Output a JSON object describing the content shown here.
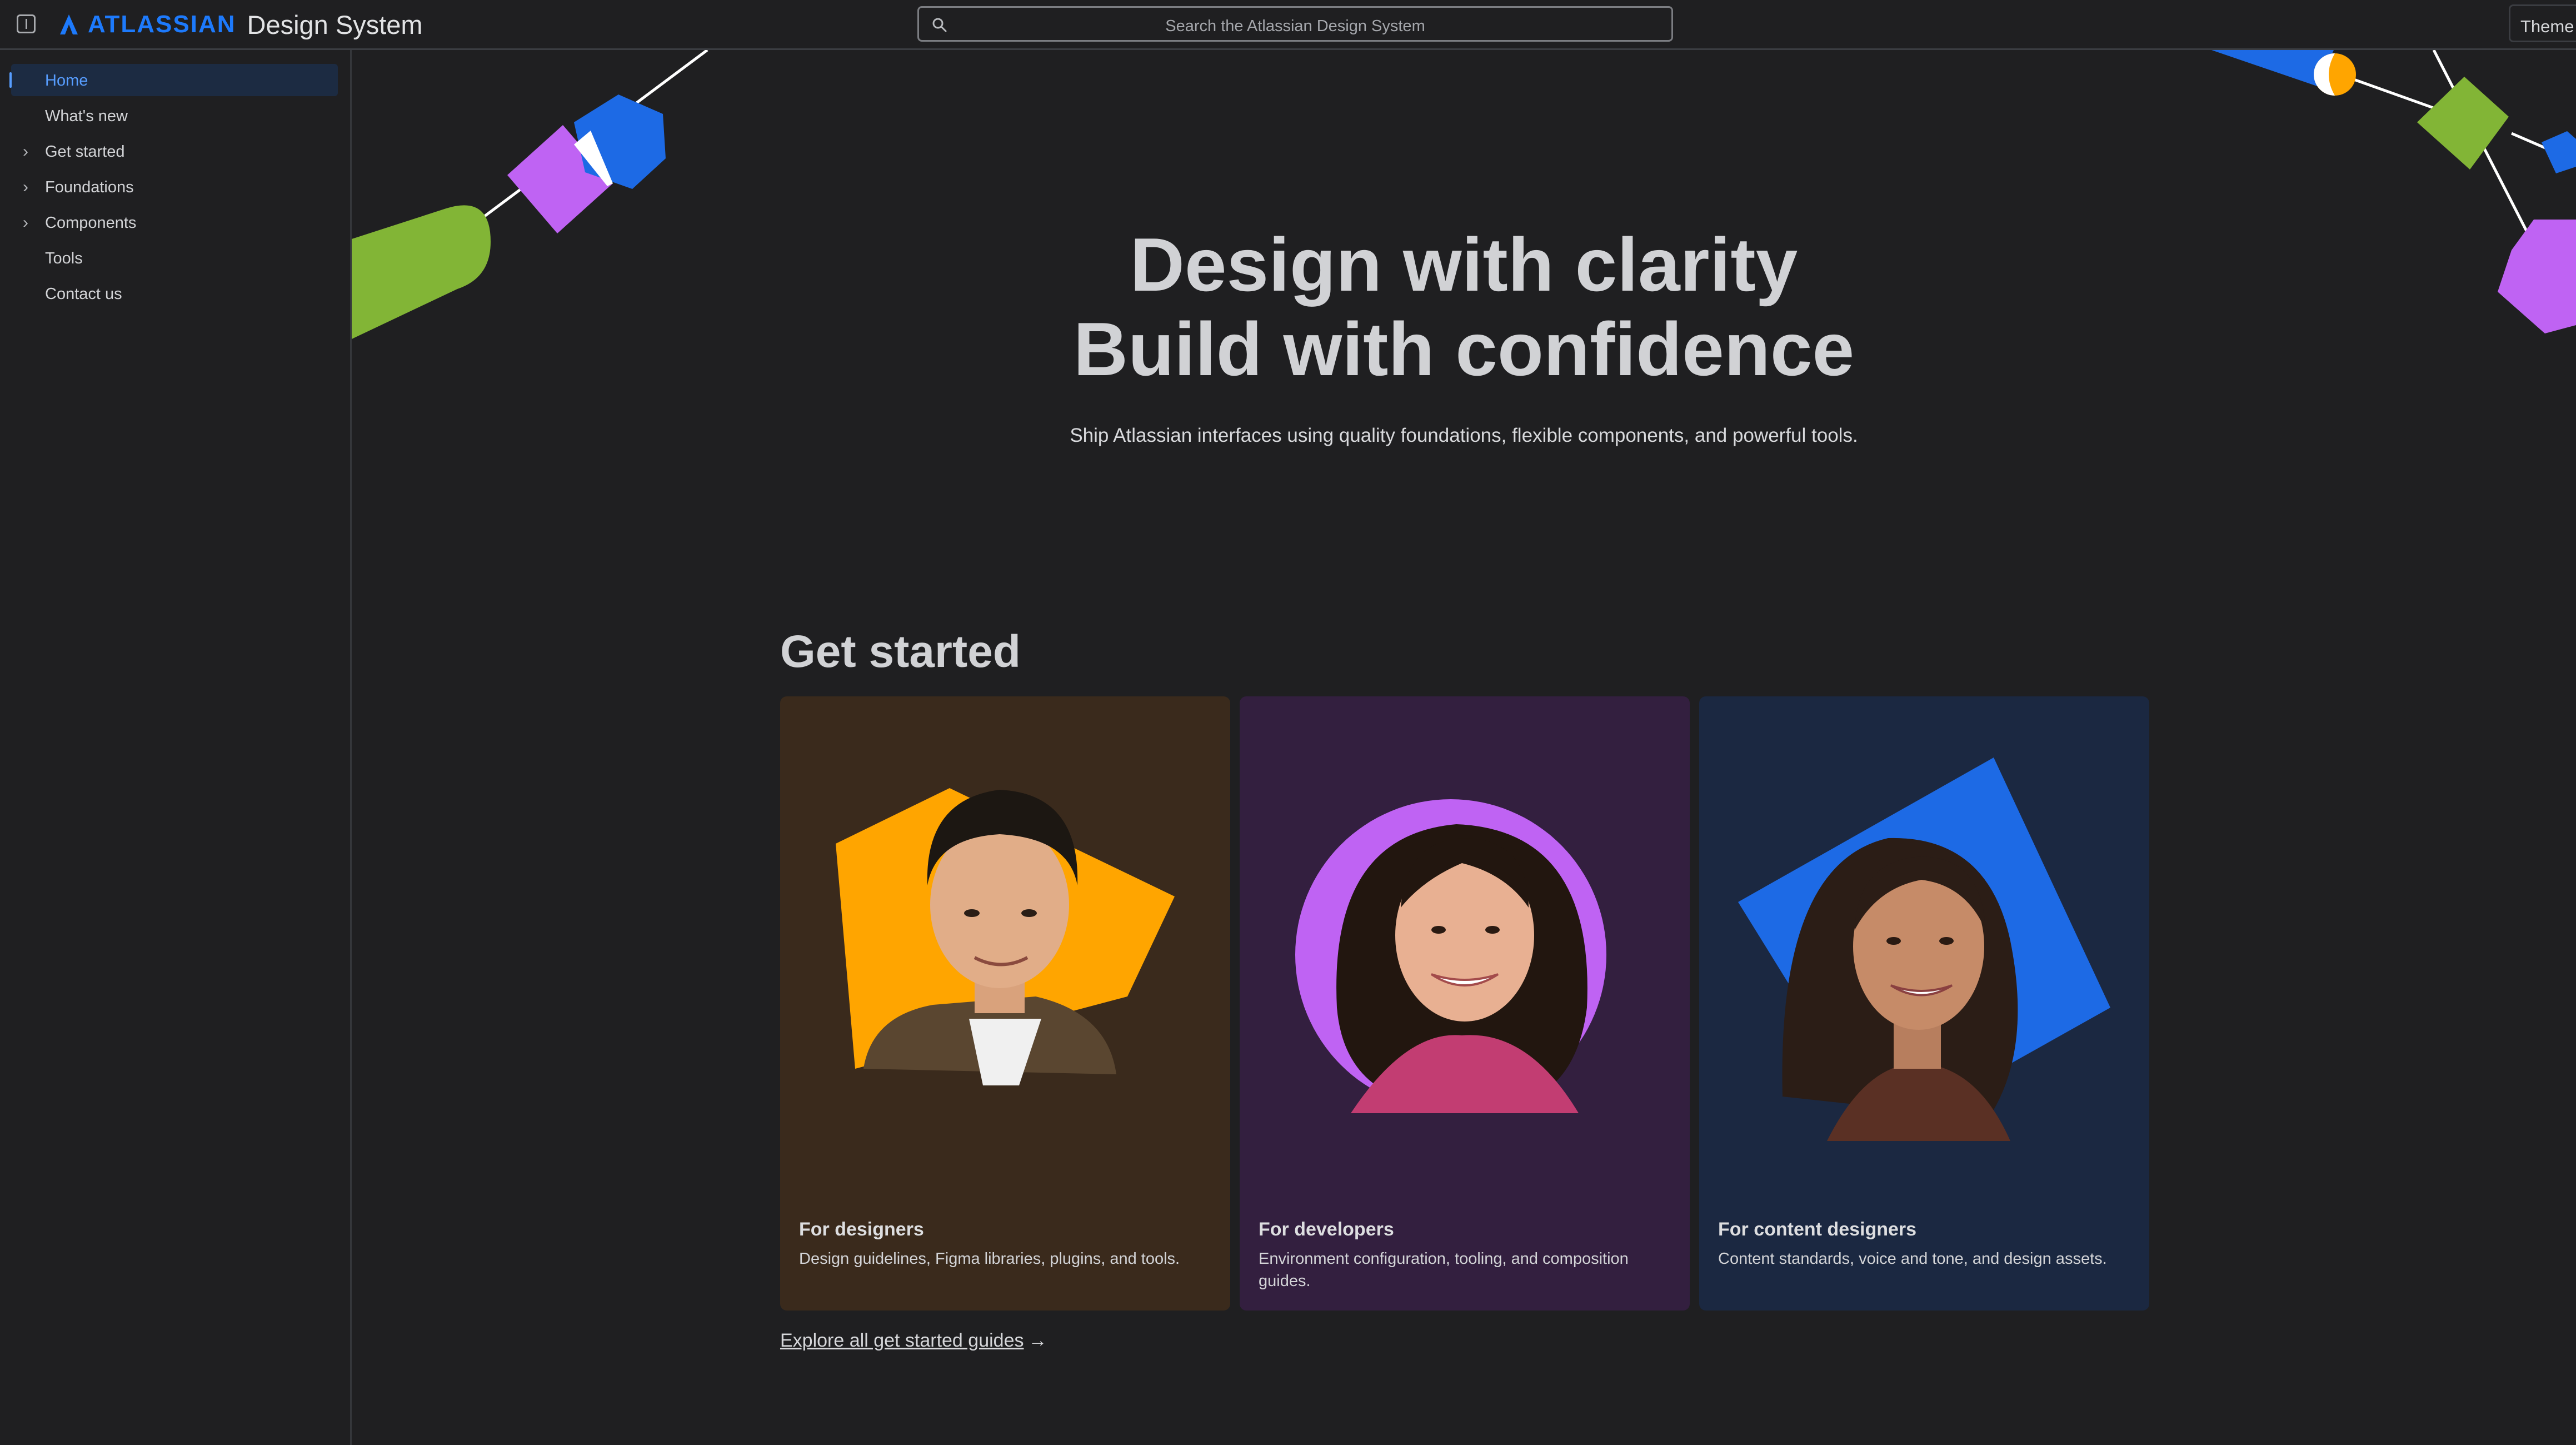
{
  "topbar": {
    "brand": "ATLASSIAN",
    "product": "Design System",
    "search_placeholder": "Search the Atlassian Design System",
    "theme_label": "Theme"
  },
  "sidebar": {
    "items": [
      {
        "label": "Home",
        "active": true,
        "expandable": false
      },
      {
        "label": "What's new",
        "active": false,
        "expandable": false
      },
      {
        "label": "Get started",
        "active": false,
        "expandable": true
      },
      {
        "label": "Foundations",
        "active": false,
        "expandable": true
      },
      {
        "label": "Components",
        "active": false,
        "expandable": true
      },
      {
        "label": "Tools",
        "active": false,
        "expandable": false
      },
      {
        "label": "Contact us",
        "active": false,
        "expandable": false
      }
    ]
  },
  "hero": {
    "title_line1": "Design with clarity",
    "title_line2": "Build with confidence",
    "subtitle": "Ship Atlassian interfaces using quality foundations, flexible components, and powerful tools."
  },
  "get_started": {
    "heading": "Get started",
    "cards": [
      {
        "title": "For designers",
        "description": "Design guidelines, Figma libraries, plugins, and tools.",
        "background": "#3a2a1c",
        "accent": "#ffa500"
      },
      {
        "title": "For developers",
        "description": "Environment configuration, tooling, and composition guides.",
        "background": "#331f3f",
        "accent": "#bf63f3"
      },
      {
        "title": "For content designers",
        "description": "Content standards, voice and tone, and design assets.",
        "background": "#1b2841",
        "accent": "#1d6ae5"
      }
    ],
    "explore_label": "Explore all get started guides",
    "explore_arrow": "→"
  },
  "colors": {
    "brand_blue": "#1d7afc",
    "link_blue": "#579dff",
    "green": "#82b536",
    "purple": "#bf63f3",
    "orange": "#ffa500"
  },
  "icons": [
    "sidebar-toggle-icon",
    "atlassian-logo-icon",
    "search-icon",
    "chevron-right-icon",
    "arrow-right-icon"
  ]
}
